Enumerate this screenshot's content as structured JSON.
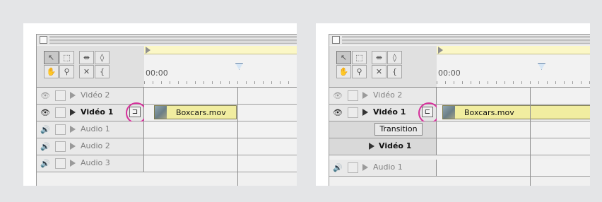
{
  "panels": [
    {
      "tools": [
        "selection-tool",
        "marquee-tool",
        "track-tool",
        "razor-tool",
        "hand-tool",
        "zoom-tool",
        "link-tool",
        "in-out-tool"
      ],
      "ruler": {
        "timecode": "00:00"
      },
      "tracks": [
        {
          "label": "Vidéo 2",
          "eye": "eye-icon"
        },
        {
          "label": "Vidéo 1",
          "eye": "eye-icon",
          "clip": "Boxcars.mov"
        },
        {
          "label": "Audio 1",
          "speaker": "speaker-icon"
        },
        {
          "label": "Audio 2",
          "speaker": "speaker-icon"
        },
        {
          "label": "Audio 3",
          "speaker": "speaker-icon"
        }
      ]
    },
    {
      "tools": [
        "selection-tool",
        "marquee-tool",
        "track-tool",
        "razor-tool",
        "hand-tool",
        "zoom-tool",
        "link-tool",
        "in-out-tool"
      ],
      "ruler": {
        "timecode": "00:00"
      },
      "tracks": [
        {
          "label": "Vidéo 2",
          "eye": "eye-icon"
        },
        {
          "label": "Vidéo 1",
          "eye": "eye-icon",
          "clip": "Boxcars.mov"
        },
        {
          "label": "Transition"
        },
        {
          "label": "Vidéo 1"
        },
        {
          "label": "Audio 1",
          "speaker": "speaker-icon"
        }
      ]
    }
  ],
  "colors": {
    "highlight_circle": "#d6309b",
    "clip_fill": "#f1eda0",
    "work_area": "#fbf7c6"
  }
}
